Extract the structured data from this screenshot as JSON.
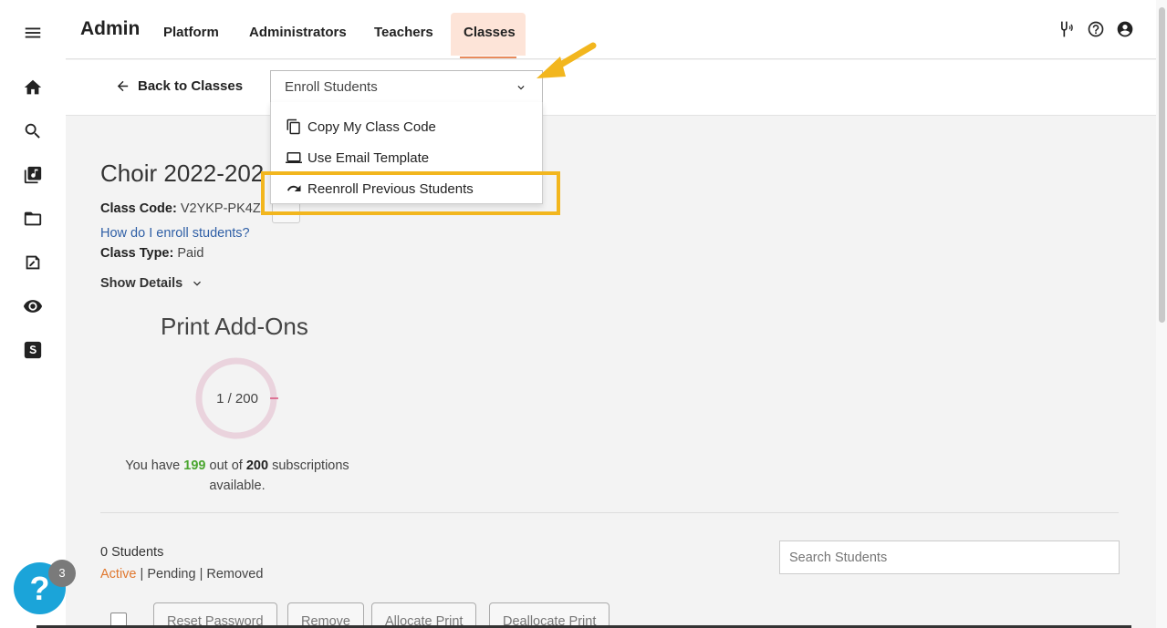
{
  "app": {
    "brand": "Admin",
    "nav": [
      {
        "label": "Platform"
      },
      {
        "label": "Administrators"
      },
      {
        "label": "Teachers"
      },
      {
        "label": "Classes"
      }
    ],
    "accent_color": "#e98a5b",
    "active_tab_bg": "#fde4d8",
    "top_icons": [
      "tuning-fork-icon",
      "help-circle-icon",
      "account-icon"
    ]
  },
  "rail": {
    "icons": [
      "menu-icon",
      "home-icon",
      "search-icon",
      "music-library-icon",
      "folder-icon",
      "assignment-icon",
      "eye-icon",
      "s-logo-icon"
    ]
  },
  "subbar": {
    "back_label": "Back to Classes"
  },
  "enroll_dropdown": {
    "selected": "Enroll Students",
    "options": [
      {
        "label": "Copy My Class Code",
        "icon": "copy-icon"
      },
      {
        "label": "Use Email Template",
        "icon": "laptop-icon"
      },
      {
        "label": "Reenroll Previous Students",
        "icon": "redo-icon"
      }
    ],
    "highlight_color": "#f2b61e"
  },
  "class_info": {
    "title": "Choir 2022-202",
    "code_label": "Class Code:",
    "code_value": "V2YKP-PK4Z",
    "help_link": "How do I enroll students?",
    "type_label": "Class Type:",
    "type_value": "Paid",
    "show_details": "Show Details"
  },
  "print_addons": {
    "title": "Print Add-Ons",
    "used": 1,
    "total": 200,
    "donut_label": "1 / 200",
    "subs_prefix": "You have",
    "subs_available": "199",
    "subs_middle": "out of",
    "subs_total": "200",
    "subs_suffix": "subscriptions",
    "subs_suffix2": "available.",
    "available_color": "#4ba630"
  },
  "students": {
    "count_label": "0 Students",
    "filters": [
      "Active",
      "Pending",
      "Removed"
    ],
    "search_placeholder": "Search Students",
    "actions": [
      "Reset Password",
      "Remove",
      "Allocate Print",
      "Deallocate Print"
    ]
  },
  "help_widget": {
    "label": "?",
    "badge": "3"
  }
}
